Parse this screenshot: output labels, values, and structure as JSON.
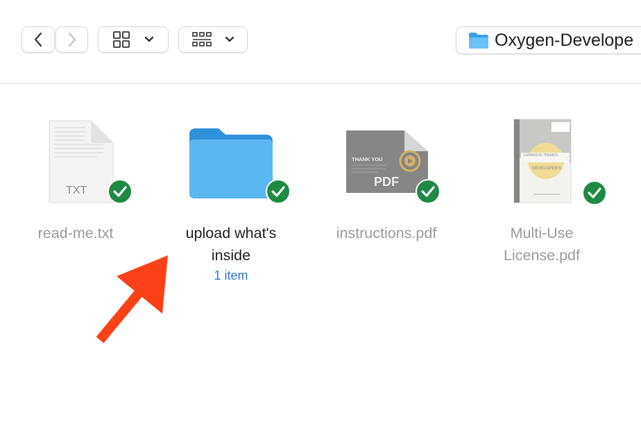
{
  "toolbar": {
    "back_icon": "chevron-left-icon",
    "forward_icon": "chevron-right-icon",
    "view_icon": "grid-view-icon",
    "group_icon": "group-icon",
    "path": {
      "label": "Oxygen-Develope",
      "icon": "folder-icon"
    }
  },
  "files": [
    {
      "name": "read-me.txt",
      "type_label": "TXT",
      "icon": "txt-document-icon",
      "synced": true,
      "selected": false
    },
    {
      "name": "upload what's inside",
      "subtitle": "1 item",
      "icon": "folder-icon",
      "synced": true,
      "selected": false
    },
    {
      "name": "instructions.pdf",
      "type_label": "PDF",
      "thumb_title": "THANK YOU",
      "icon": "pdf-thumbnail-icon",
      "synced": true,
      "selected": false
    },
    {
      "name": "Multi-Use License.pdf",
      "thumb_title": "DEVELOPER'S",
      "thumb_subtitle": "LUMINOUS THEMES",
      "icon": "pdf-thumbnail-icon",
      "synced": true,
      "selected": false
    }
  ],
  "colors": {
    "accent": "#2f74d0",
    "synced_badge": "#1f8a44",
    "folder": "#5ab7f0",
    "annotation_arrow": "#fc4119"
  }
}
